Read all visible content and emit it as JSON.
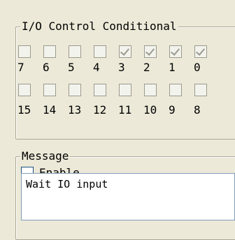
{
  "io_group": {
    "title": "I/O Control Conditional",
    "row1": [
      {
        "label": "7",
        "checked": false
      },
      {
        "label": "6",
        "checked": false
      },
      {
        "label": "5",
        "checked": false
      },
      {
        "label": "4",
        "checked": false
      },
      {
        "label": "3",
        "checked": true
      },
      {
        "label": "2",
        "checked": true
      },
      {
        "label": "1",
        "checked": true
      },
      {
        "label": "0",
        "checked": true
      }
    ],
    "row2": [
      {
        "label": "15",
        "checked": false
      },
      {
        "label": "14",
        "checked": false
      },
      {
        "label": "13",
        "checked": false
      },
      {
        "label": "12",
        "checked": false
      },
      {
        "label": "11",
        "checked": false
      },
      {
        "label": "10",
        "checked": false
      },
      {
        "label": "9",
        "checked": false
      },
      {
        "label": "8",
        "checked": false
      }
    ]
  },
  "message_group": {
    "title": "Message",
    "enable_label": "Enable",
    "enable_checked": false,
    "message_text": "Wait IO input"
  }
}
